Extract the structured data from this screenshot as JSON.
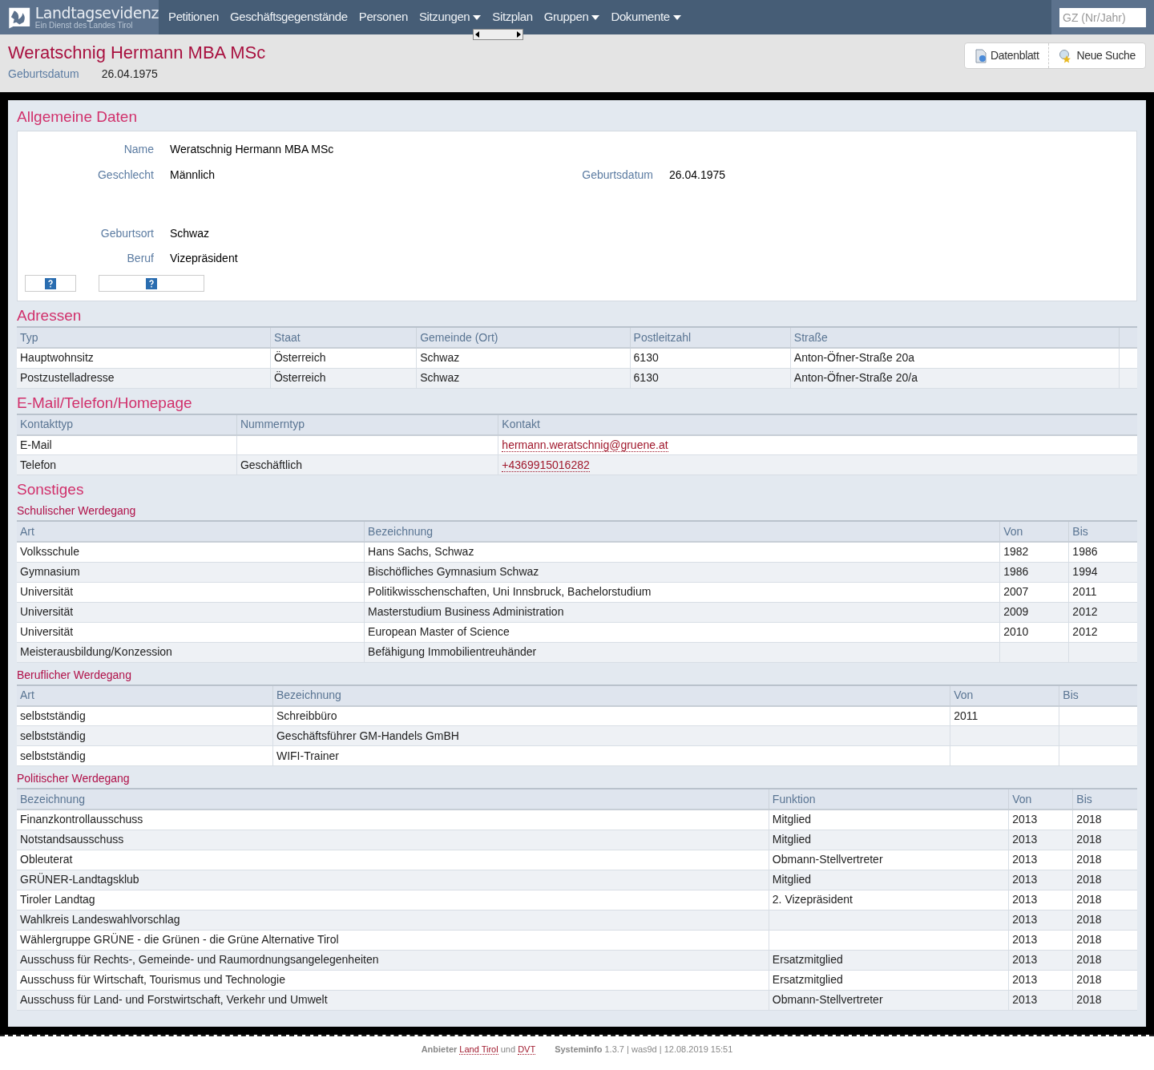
{
  "nav": {
    "app_title": "Landtagsevidenz",
    "app_subtitle": "Ein Dienst des Landes Tirol",
    "items": [
      {
        "label": "Petitionen",
        "dropdown": false
      },
      {
        "label": "Geschäftsgegenstände",
        "dropdown": false
      },
      {
        "label": "Personen",
        "dropdown": false
      },
      {
        "label": "Sitzungen",
        "dropdown": true
      },
      {
        "label": "Sitzplan",
        "dropdown": false
      },
      {
        "label": "Gruppen",
        "dropdown": true
      },
      {
        "label": "Dokumente",
        "dropdown": true
      }
    ],
    "search": {
      "placeholder": "GZ (Nr/Jahr)"
    }
  },
  "header": {
    "title": "Weratschnig Hermann MBA MSc",
    "birth_label": "Geburtsdatum",
    "birth_value": "26.04.1975",
    "buttons": [
      "Datenblatt",
      "Neue Suche"
    ]
  },
  "general": {
    "title": "Allgemeine Daten",
    "name_label": "Name",
    "name": "Weratschnig Hermann MBA MSc",
    "gender_label": "Geschlecht",
    "gender": "Männlich",
    "birth_label": "Geburtsdatum",
    "birth": "26.04.1975",
    "place_label": "Geburtsort",
    "place": "Schwaz",
    "job_label": "Beruf",
    "job": "Vizepräsident"
  },
  "sections": [
    {
      "title": "Adressen",
      "tables": [
        {
          "columns": [
            {
              "label": "Typ",
              "kind": "text"
            },
            {
              "label": "Staat",
              "kind": "text"
            },
            {
              "label": "Gemeinde (Ort)",
              "kind": "text"
            },
            {
              "label": "Postleitzahl",
              "kind": "text"
            },
            {
              "label": "Straße",
              "kind": "text"
            },
            {
              "kind": "text"
            }
          ],
          "rows": [
            [
              "Hauptwohnsitz",
              "Österreich",
              "Schwaz",
              "6130",
              "Anton-Öfner-Straße 20a",
              null
            ],
            [
              "Postzustelladresse",
              "Österreich",
              "Schwaz",
              "6130",
              "Anton-Öfner-Straße 20/a",
              null
            ]
          ]
        }
      ]
    },
    {
      "title": "E-Mail/Telefon/Homepage",
      "tables": [
        {
          "columns": [
            {
              "label": "Kontakttyp",
              "kind": "text"
            },
            {
              "label": "Nummerntyp",
              "kind": "text"
            },
            {
              "label": "Kontakt",
              "kind": "link"
            }
          ],
          "rows": [
            [
              "E-Mail",
              null,
              "hermann.weratschnig@gruene.at"
            ],
            [
              "Telefon",
              "Geschäftlich",
              "+4369915016282"
            ]
          ]
        }
      ]
    },
    {
      "title": "Sonstiges",
      "tables": [
        {
          "subtitle": "Schulischer Werdegang",
          "columns": [
            {
              "label": "Art",
              "kind": "text"
            },
            {
              "label": "Bezeichnung",
              "kind": "text"
            },
            {
              "label": "Von",
              "kind": "text"
            },
            {
              "label": "Bis",
              "kind": "text"
            }
          ],
          "rows": [
            [
              "Volksschule",
              "Hans Sachs, Schwaz",
              "1982",
              "1986"
            ],
            [
              "Gymnasium",
              "Bischöfliches Gymnasium Schwaz",
              "1986",
              "1994"
            ],
            [
              "Universität",
              "Politikwisschenschaften, Uni Innsbruck, Bachelorstudium",
              "2007",
              "2011"
            ],
            [
              "Universität",
              "Masterstudium Business Administration",
              "2009",
              "2012"
            ],
            [
              "Universität",
              "European Master of Science",
              "2010",
              "2012"
            ],
            [
              "Meisterausbildung/Konzession",
              "Befähigung Immobilientreuhänder",
              null,
              null
            ]
          ]
        },
        {
          "subtitle": "Beruflicher Werdegang",
          "columns": [
            {
              "label": "Art",
              "kind": "text"
            },
            {
              "label": "Bezeichnung",
              "kind": "text"
            },
            {
              "label": "Von",
              "kind": "text"
            },
            {
              "label": "Bis",
              "kind": "text"
            }
          ],
          "rows": [
            [
              "selbstständig",
              "Schreibbüro",
              "2011",
              null
            ],
            [
              "selbstständig",
              "Geschäftsführer GM-Handels GmBH",
              null,
              null
            ],
            [
              "selbstständig",
              "WIFI-Trainer",
              null,
              null
            ]
          ]
        },
        {
          "subtitle": "Politischer Werdegang",
          "columns": [
            {
              "label": "Bezeichnung",
              "kind": "text"
            },
            {
              "label": "Funktion",
              "kind": "text"
            },
            {
              "label": "Von",
              "kind": "text"
            },
            {
              "label": "Bis",
              "kind": "text"
            }
          ],
          "rows": [
            [
              "Finanzkontrollausschuss",
              "Mitglied",
              "2013",
              "2018"
            ],
            [
              "Notstandsausschuss",
              "Mitglied",
              "2013",
              "2018"
            ],
            [
              "Obleuterat",
              "Obmann-Stellvertreter",
              "2013",
              "2018"
            ],
            [
              "GRÜNER-Landtagsklub",
              "Mitglied",
              "2013",
              "2018"
            ],
            [
              "Tiroler Landtag",
              "2. Vizepräsident",
              "2013",
              "2018"
            ],
            [
              "Wahlkreis Landeswahlvorschlag",
              null,
              "2013",
              "2018"
            ],
            [
              "Wählergruppe GRÜNE - die Grünen - die Grüne Alternative Tirol",
              null,
              "2013",
              "2018"
            ],
            [
              "Ausschuss für Rechts-, Gemeinde- und Raumordnungsangelegenheiten",
              "Ersatzmitglied",
              "2013",
              "2018"
            ],
            [
              "Ausschuss für Wirtschaft, Tourismus und Technologie",
              "Ersatzmitglied",
              "2013",
              "2018"
            ],
            [
              "Ausschuss für Land- und Forstwirtschaft, Verkehr und Umwelt",
              "Obmann-Stellvertreter",
              "2013",
              "2018"
            ]
          ]
        }
      ]
    }
  ],
  "footer": {
    "provider_label": "Anbieter",
    "provider_link": "Land Tirol",
    "and": "und",
    "second_link": "DVT",
    "sysinfo_label": "Systeminfo",
    "sysinfo": "1.3.7 | was9d | 12.08.2019 15:51"
  }
}
